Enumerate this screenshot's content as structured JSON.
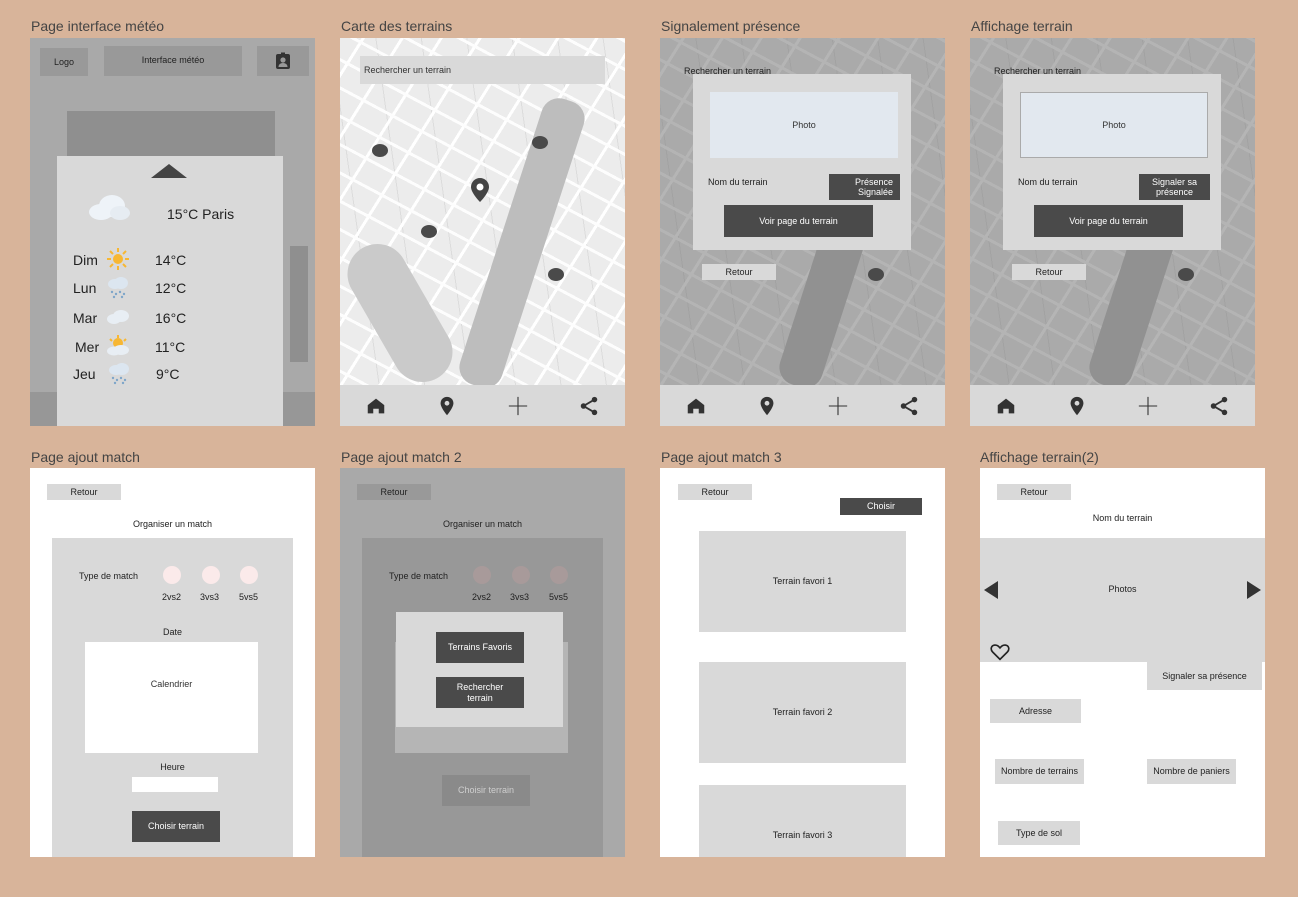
{
  "frames": {
    "meteo": {
      "title": "Page interface météo",
      "logo": "Logo",
      "header_title": "Interface météo",
      "current": "15°C Paris",
      "days": [
        {
          "day": "Dim",
          "temp": "14°C",
          "icon": "sun-icon"
        },
        {
          "day": "Lun",
          "temp": "12°C",
          "icon": "rain-icon"
        },
        {
          "day": "Mar",
          "temp": "16°C",
          "icon": "cloud-icon"
        },
        {
          "day": "Mer",
          "temp": "11°C",
          "icon": "sun-cloud-icon"
        },
        {
          "day": "Jeu",
          "temp": "9°C",
          "icon": "rain-icon"
        }
      ]
    },
    "carte": {
      "title": "Carte des terrains",
      "search": "Rechercher un terrain"
    },
    "signalement": {
      "title": "Signalement présence",
      "search": "Rechercher un terrain",
      "photo": "Photo",
      "name": "Nom du terrain",
      "status": "Présence Signalée",
      "view": "Voir page du terrain",
      "back": "Retour"
    },
    "affichage": {
      "title": "Affichage terrain",
      "search": "Rechercher un terrain",
      "photo": "Photo",
      "name": "Nom du terrain",
      "signal": "Signaler sa présence",
      "view": "Voir page du terrain",
      "back": "Retour"
    },
    "ajout1": {
      "title": "Page ajout match",
      "back": "Retour",
      "heading": "Organiser un match",
      "type_label": "Type de match",
      "types": [
        "2vs2",
        "3vs3",
        "5vs5"
      ],
      "date": "Date",
      "calendar": "Calendrier",
      "hour": "Heure",
      "choose": "Choisir terrain"
    },
    "ajout2": {
      "title": "Page ajout match 2",
      "back": "Retour",
      "heading": "Organiser un match",
      "type_label": "Type de match",
      "types": [
        "2vs2",
        "3vs3",
        "5vs5"
      ],
      "favorites": "Terrains Favoris",
      "search": "Rechercher terrain",
      "choose": "Choisir terrain"
    },
    "ajout3": {
      "title": "Page ajout match 3",
      "back": "Retour",
      "choose": "Choisir",
      "fav": [
        "Terrain favori 1",
        "Terrain favori 2",
        "Terrain favori 3"
      ]
    },
    "affichage2": {
      "title": "Affichage terrain(2)",
      "back": "Retour",
      "name": "Nom du terrain",
      "photos": "Photos",
      "signal": "Signaler sa présence",
      "address": "Adresse",
      "nb_terrains": "Nombre de terrains",
      "nb_paniers": "Nombre de paniers",
      "sol": "Type de sol"
    }
  },
  "colors": {
    "background": "#d8b49a",
    "dark_button": "#4a4a4a",
    "light_box": "#d9d9d9"
  }
}
